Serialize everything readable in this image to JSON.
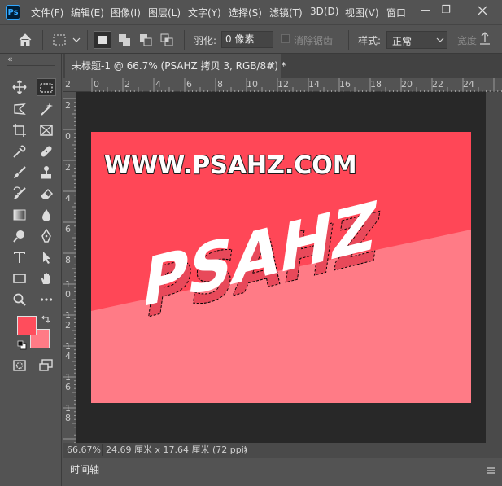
{
  "app": {
    "logo_text": "Ps"
  },
  "menu": [
    "文件(F)",
    "编辑(E)",
    "图像(I)",
    "图层(L)",
    "文字(Y)",
    "选择(S)",
    "滤镜(T)",
    "3D(D)",
    "视图(V)",
    "窗口"
  ],
  "window_controls": {
    "minimize": "—",
    "restore": "❐"
  },
  "options": {
    "feather_label": "羽化:",
    "feather_value": "0 像素",
    "antialias_label": "消除锯齿",
    "style_label": "样式:",
    "style_value": "正常",
    "width_label": "宽度"
  },
  "toolbar": {
    "collapse": "«"
  },
  "document": {
    "tab_title": "未标题-1 @ 66.7% (PSAHZ 拷贝 3, RGB/8#) *",
    "tab_close": "×"
  },
  "rulers": {
    "top": [
      "0",
      "2",
      "4",
      "6",
      "8",
      "10",
      "12",
      "14",
      "16",
      "18",
      "20",
      "22",
      "24"
    ],
    "top_edge": "2",
    "left": [
      "2",
      "0",
      "2",
      "4",
      "6",
      "8",
      "1 0",
      "1 2",
      "1 4",
      "1 6",
      "1 8"
    ]
  },
  "canvas_content": {
    "headline": "WWW.PSAHZ.COM",
    "art_text": "PSAHZ",
    "colors": {
      "top_red": "#ff4757",
      "bottom_pink": "#ff7b86"
    }
  },
  "status": {
    "zoom": "66.67%",
    "doc_size": "24.69 厘米 x 17.64 厘米 (72 ppi)",
    "arrow": "›"
  },
  "timeline": {
    "label": "时间轴"
  },
  "swatches": {
    "foreground": "#ff4d5c",
    "background": "#ff7b86"
  }
}
